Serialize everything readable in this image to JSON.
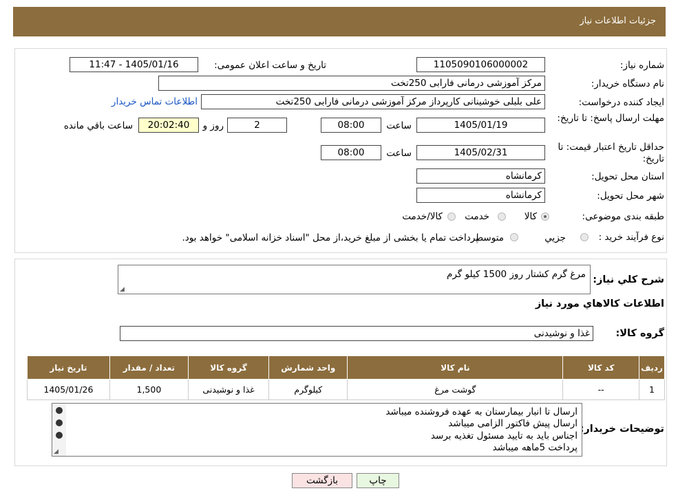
{
  "header": {
    "title": "جزئیات اطلاعات نیاز"
  },
  "fields": {
    "need_no_label": "شماره نیاز:",
    "need_no": "1105090106000002",
    "announce_label": "تاریخ و ساعت اعلان عمومی:",
    "announce": "1405/01/16 - 11:47",
    "buyer_label": "نام دستگاه خریدار:",
    "buyer": "مرکز آموزشی  درمانی فارابی 250تخت",
    "creator_label": "ایجاد کننده درخواست:",
    "creator": "علی بلبلی خوشینانی کارپرداز مرکز آموزشی  درمانی فارابی 250تخت",
    "contact_link": "اطلاعات تماس خریدار",
    "deadline_label": "مهلت ارسال پاسخ: تا تاریخ:",
    "deadline_date": "1405/01/19",
    "time_label": "ساعت",
    "deadline_time": "08:00",
    "days": "2",
    "days_label": "روز و",
    "remaining": "20:02:40",
    "remaining_label": "ساعت باقي مانده",
    "validity_label": "حداقل تاریخ اعتبار قیمت: تا تاریخ:",
    "validity_date": "1405/02/31",
    "validity_time": "08:00",
    "province_label": "استان محل تحویل:",
    "province": "کرمانشاه",
    "city_label": "شهر محل تحویل:",
    "city": "کرمانشاه",
    "category_label": "طبقه بندی موضوعی:",
    "cat_goods": "کالا",
    "cat_service": "خدمت",
    "cat_both": "کالا/خدمت",
    "process_label": "نوع فرآیند خرید :",
    "proc_partial": "جزیي",
    "proc_medium": "متوسط",
    "proc_note": "پرداخت تمام یا بخشی از مبلغ خرید،از محل \"اسناد خزانه اسلامی\" خواهد بود."
  },
  "details": {
    "desc_label": "شرح کلي نیاز:",
    "desc": "مرغ گرم کشتار روز 1500 کیلو گرم",
    "goods_title": "اطلاعات کالاهاي مورد نیاز",
    "group_label": "گروه کالا:",
    "group": "غذا و نوشیدنی"
  },
  "table": {
    "headers": [
      "ردیف",
      "کد کالا",
      "نام کالا",
      "واحد شمارش",
      "گروه کالا",
      "تعداد / مقدار",
      "تاریخ نیاز"
    ],
    "rows": [
      [
        "1",
        "--",
        "گوشت مرغ",
        "کیلوگرم",
        "غذا و نوشیدنی",
        "1,500",
        "1405/01/26"
      ]
    ]
  },
  "notes": {
    "label": "توضیحات خریدار:",
    "lines": [
      "ارسال تا انبار بیمارستان به عهده فروشنده میباشد",
      "ارسال پیش فاکتور الزامی میباشد",
      "اجناس باید به تایید مسئول تغذیه برسد",
      "پرداخت 5ماهه میباشد"
    ]
  },
  "buttons": {
    "print": "چاپ",
    "back": "بازگشت"
  },
  "colors": {
    "header_bg": "#8c6d3d",
    "link": "#1a56c4",
    "back_btn_bg": "#fbe3e3",
    "print_btn_bg": "#e8f7e0"
  }
}
